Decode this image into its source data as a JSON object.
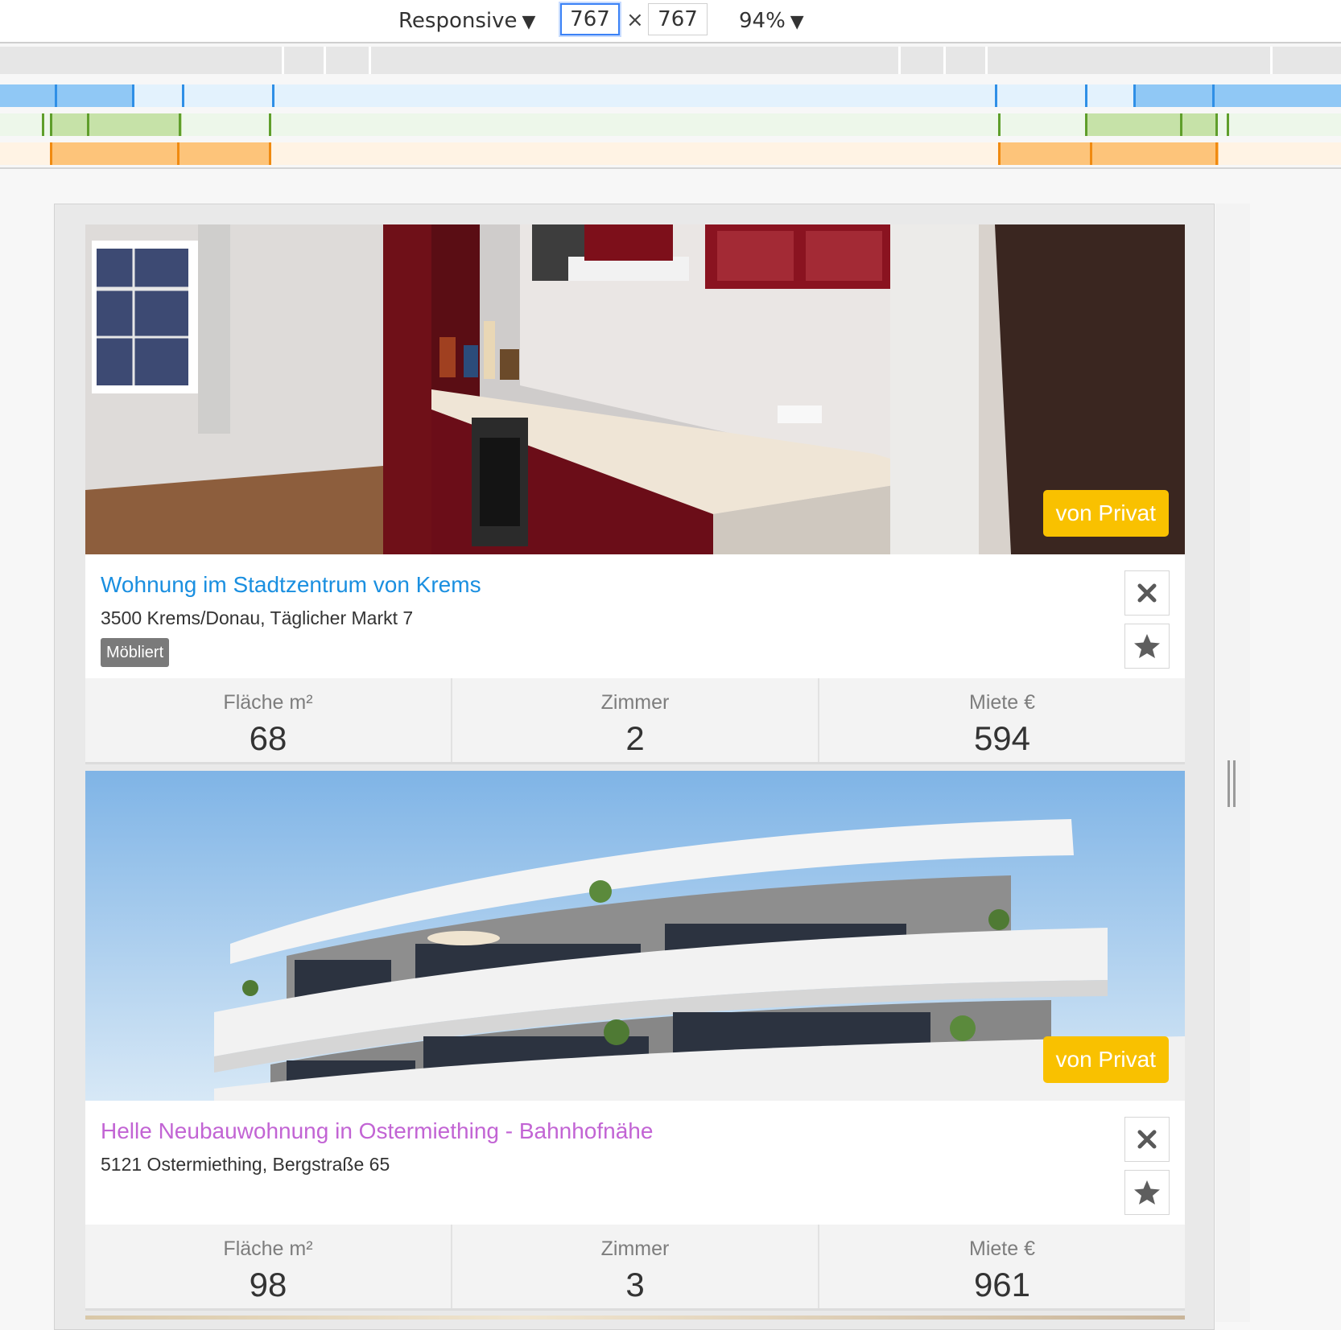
{
  "devtools": {
    "device_label": "Responsive",
    "width_value": "767",
    "height_value": "767",
    "times_symbol": "×",
    "zoom_label": "94%",
    "caret_icon": "▼",
    "colors": {
      "blue": "#90c8f5",
      "green": "#c6e2a8",
      "orange": "#fdc47a"
    }
  },
  "listings": [
    {
      "title": "Wohnung im Stadtzentrum von Krems",
      "address": "3500 Krems/Donau, Täglicher Markt 7",
      "tag": "Möbliert",
      "badge": "von Privat",
      "photo": "kitchen-photo",
      "stats": [
        {
          "label": "Fläche m²",
          "value": "68"
        },
        {
          "label": "Zimmer",
          "value": "2"
        },
        {
          "label": "Miete €",
          "value": "594"
        }
      ]
    },
    {
      "title": "Helle Neubauwohnung in Ostermiething - Bahnhofnähe",
      "address": "5121 Ostermiething, Bergstraße 65",
      "badge": "von Privat",
      "photo": "building-photo",
      "stats": [
        {
          "label": "Fläche m²",
          "value": "98"
        },
        {
          "label": "Zimmer",
          "value": "3"
        },
        {
          "label": "Miete €",
          "value": "961"
        }
      ]
    }
  ],
  "icons": {
    "close": "close-icon",
    "favorite": "star-icon"
  }
}
